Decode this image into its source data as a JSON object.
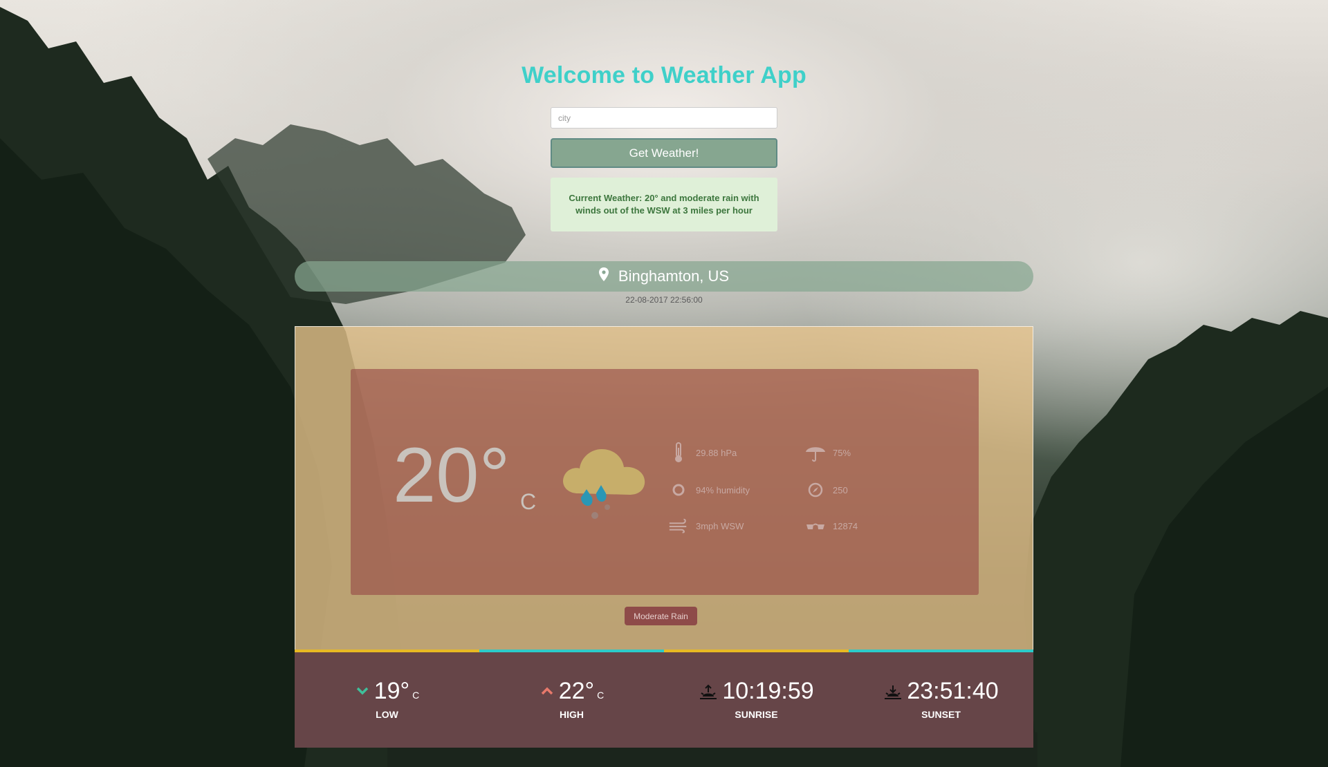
{
  "header": {
    "title": "Welcome to Weather App"
  },
  "search": {
    "placeholder": "city",
    "value": ""
  },
  "button": {
    "label": "Get Weather!"
  },
  "alert": {
    "text": "Current Weather: 20° and moderate rain with winds out of the WSW at 3 miles per hour"
  },
  "location": {
    "name": "Binghamton, US",
    "icon": "map-pin-icon",
    "datetime": "22-08-2017 22:56:00"
  },
  "current": {
    "temp": "20°",
    "unit": "C",
    "condition_icon": "cloud-rain-icon",
    "stats": {
      "pressure": "29.88 hPa",
      "humidity": "94% humidity",
      "wind": "3mph WSW",
      "precip": "75%",
      "direction": "250",
      "visibility": "12874"
    },
    "description": "Moderate Rain"
  },
  "colors": {
    "title": "#3fd0c9",
    "button": "#86a690",
    "stripe_yellow": "#e8b923",
    "stripe_teal": "#2ccbc9",
    "footer": "#664548"
  },
  "forecast": [
    {
      "value": "19°",
      "unit": "C",
      "label": "LOW",
      "icon": "chevron-down-icon"
    },
    {
      "value": "22°",
      "unit": "C",
      "label": "HIGH",
      "icon": "chevron-up-icon"
    },
    {
      "value": "10:19:59",
      "unit": "",
      "label": "SUNRISE",
      "icon": "sunrise-icon"
    },
    {
      "value": "23:51:40",
      "unit": "",
      "label": "SUNSET",
      "icon": "sunset-icon"
    }
  ]
}
